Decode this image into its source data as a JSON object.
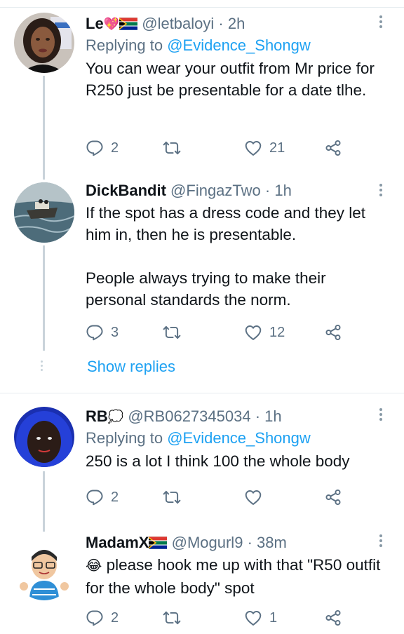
{
  "replies": [
    {
      "display_name": "Le",
      "display_emoji": "💖",
      "handle": "@letbaloyi",
      "separator": "·",
      "time": "2h",
      "replying_prefix": "Replying to",
      "replying_to": "@Evidence_Shongw",
      "text": "You can wear your outfit from Mr price for R250 just be presentable for a date tlhe.",
      "reply_count": "2",
      "retweet_count": "",
      "like_count": "21"
    },
    {
      "display_name": "DickBandit",
      "handle": "@FingazTwo",
      "separator": "·",
      "time": "1h",
      "text_line1": "If the spot has a dress code and they let him in, then he is presentable.",
      "text_line2": "People always trying to make their personal standards the norm.",
      "reply_count": "3",
      "retweet_count": "",
      "like_count": "12"
    },
    {
      "display_name": "RB",
      "display_emoji": "💭",
      "handle": "@RB0627345034",
      "separator": "·",
      "time": "1h",
      "replying_prefix": "Replying to",
      "replying_to": "@Evidence_Shongw",
      "text": "250 is a lot I think 100 the whole body",
      "reply_count": "2",
      "retweet_count": "",
      "like_count": ""
    },
    {
      "display_name": "MadamX",
      "handle": "@Mogurl9",
      "separator": "·",
      "time": "38m",
      "text_emoji": "😂",
      "text": "please hook me up with that \"R50 outfit for the whole body\" spot",
      "reply_count": "2",
      "retweet_count": "",
      "like_count": "1"
    }
  ],
  "show_replies_label": "Show replies",
  "colors": {
    "link": "#1da1f2",
    "muted": "#5b7083",
    "text": "#0f1419",
    "divider": "#e6ecf0",
    "thread_line": "#c9d3da"
  },
  "icons": [
    "reply-icon",
    "retweet-icon",
    "like-icon",
    "share-icon",
    "more-icon",
    "south-africa-flag-icon"
  ]
}
